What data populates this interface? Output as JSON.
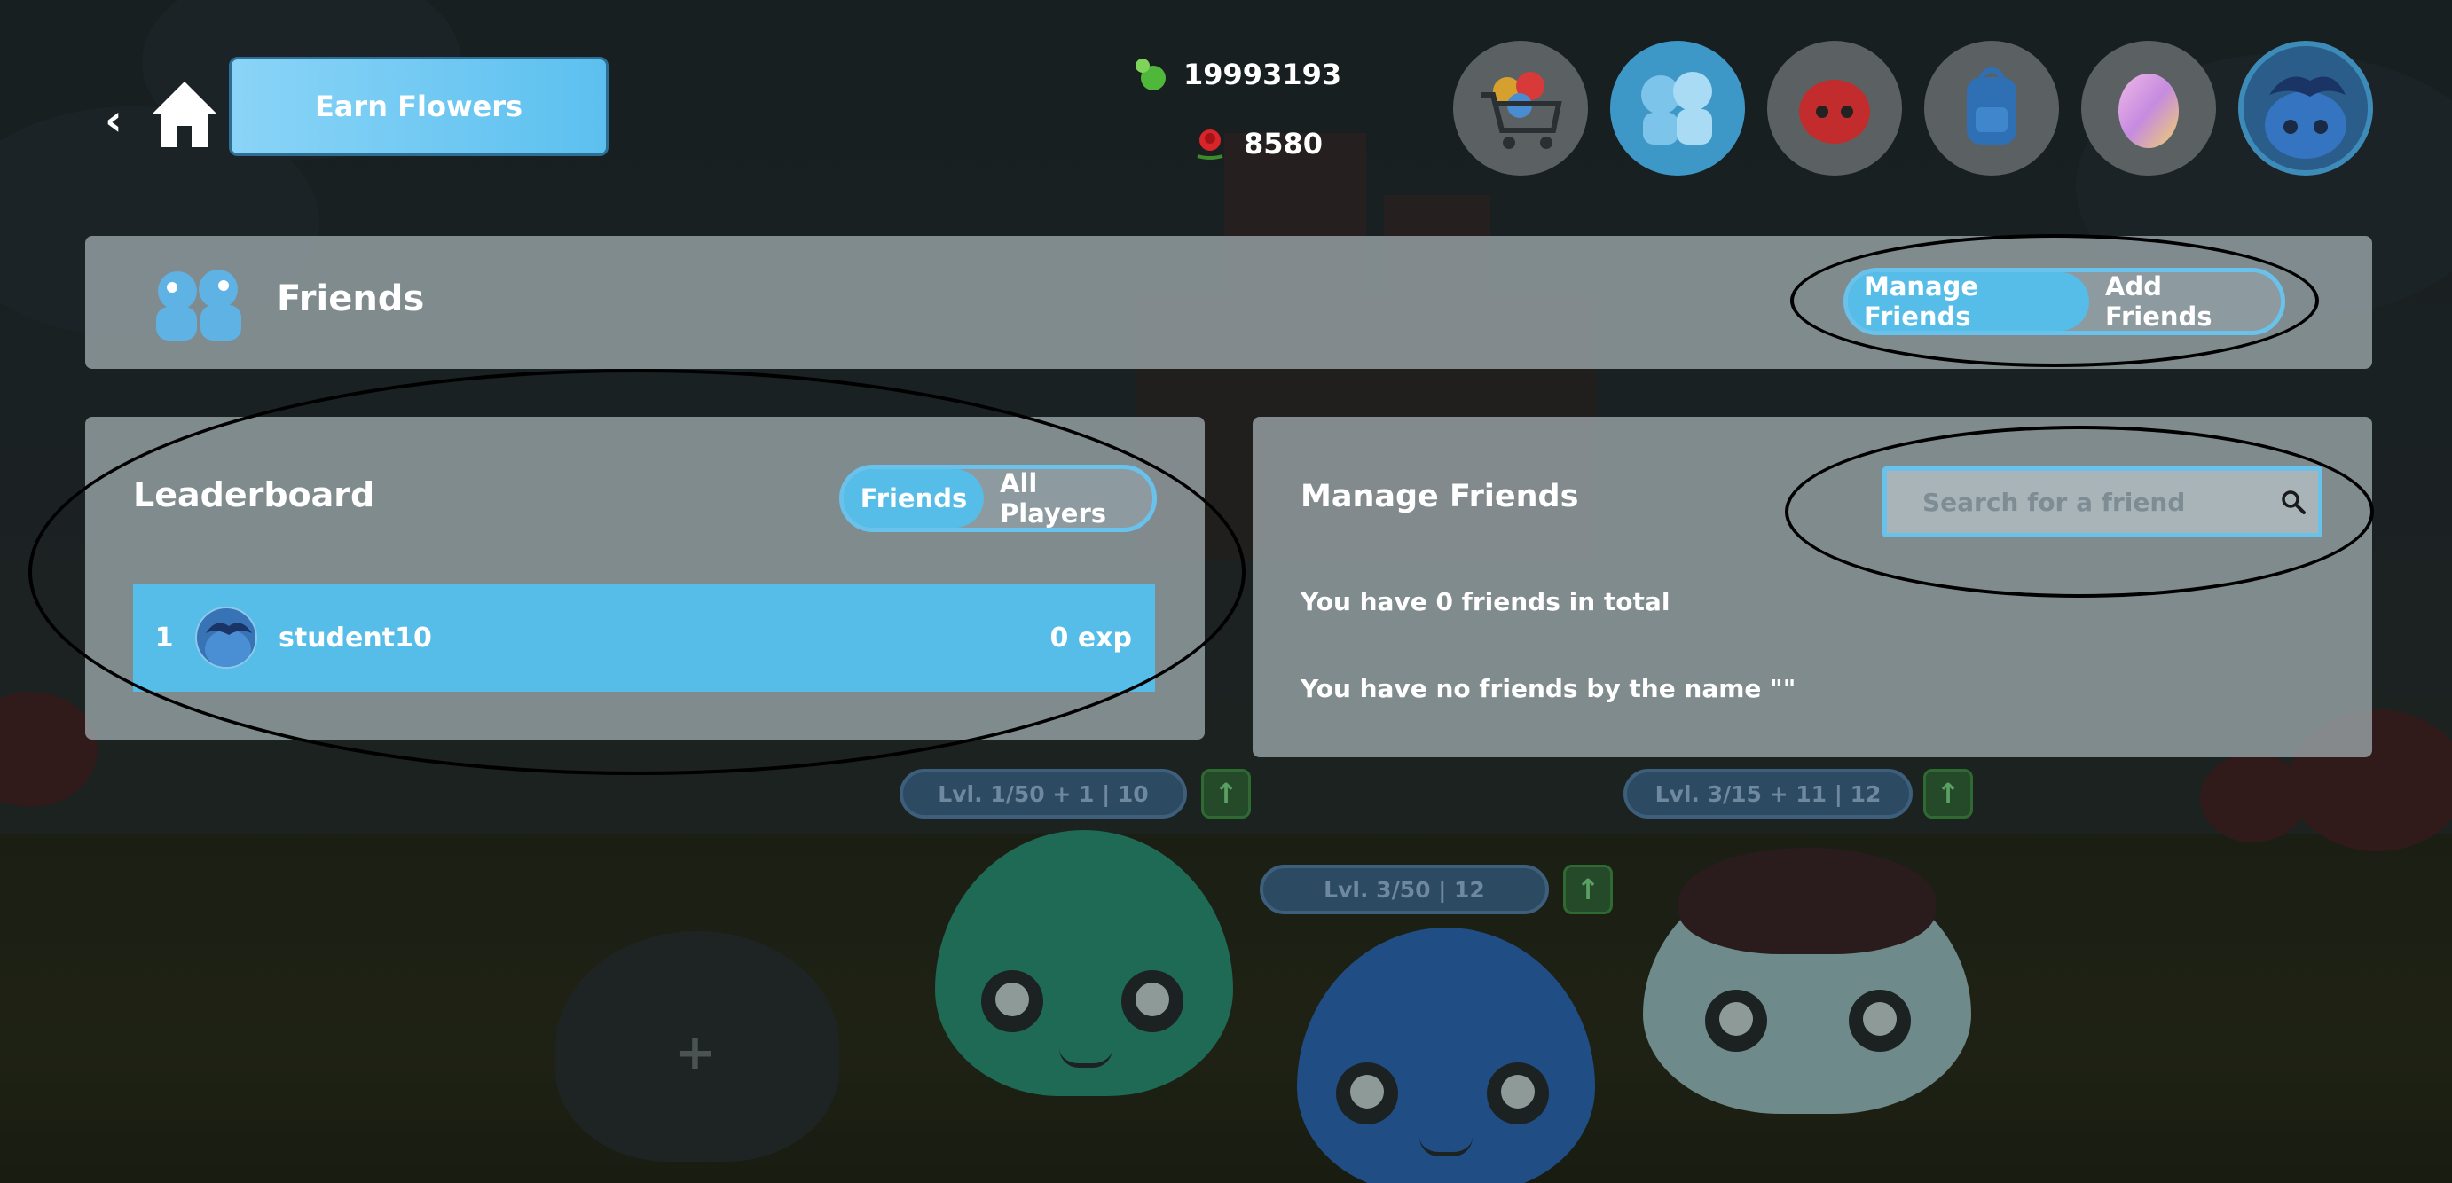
{
  "topbar": {
    "earn_label": "Earn Flowers",
    "currency_green": "19993193",
    "currency_rose": "8580",
    "nav": [
      "shop-icon",
      "friends-icon",
      "red-slime-icon",
      "backpack-icon",
      "egg-icon",
      "profile-avatar"
    ]
  },
  "header": {
    "title": "Friends",
    "tab_manage": "Manage Friends",
    "tab_add": "Add Friends"
  },
  "leaderboard": {
    "title": "Leaderboard",
    "toggle_friends": "Friends",
    "toggle_all": "All Players",
    "rows": [
      {
        "rank": "1",
        "name": "student10",
        "exp": "0 exp"
      }
    ]
  },
  "manage": {
    "title": "Manage Friends",
    "search_placeholder": "Search for a friend",
    "total_text": "You have 0 friends in total",
    "none_text": "You have no friends by the name \"\""
  },
  "background": {
    "pills": [
      "Lvl. 1/50 + 1  |  10",
      "Lvl. 3/50  |  12",
      "Lvl. 3/15 + 11  |  12"
    ],
    "plus": "+"
  },
  "colors": {
    "accent": "#56bde9",
    "panel": "#a8b4b8",
    "earn": "#5cc0ef"
  }
}
